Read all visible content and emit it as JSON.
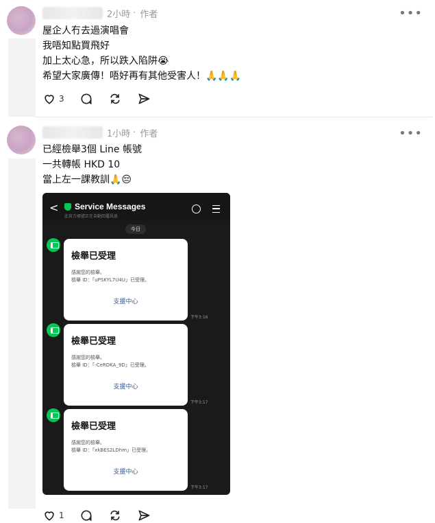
{
  "post1": {
    "time": "2小時",
    "separator": "·",
    "role": "作者",
    "more": "•••",
    "lines": [
      "屋企人冇去過演唱會",
      "我唔知點買飛好",
      "加上太心急，所以跌入陷阱😭",
      "希望大家廣傳！唔好再有其他受害人！🙏🙏🙏"
    ],
    "like_count": "3"
  },
  "post2": {
    "time": "1小時",
    "separator": "·",
    "role": "作者",
    "more": "•••",
    "lines": [
      "已經檢舉3個 Line 帳號",
      "一共轉帳 HKD 10",
      "當上左一課教訓🙏😔"
    ],
    "like_count": "1"
  },
  "line_screenshot": {
    "back": "<",
    "header_title": "Service Messages",
    "header_subtitle": "此官方帳號正在自動回覆訊息",
    "date_label": "今日",
    "cards": [
      {
        "title": "檢舉已受理",
        "thanks": "感謝您的檢舉。",
        "report_line": "檢舉 ID：「uPSKYL7U4U」已受理。",
        "link": "支援中心",
        "time": "下午3:16"
      },
      {
        "title": "檢舉已受理",
        "thanks": "感謝您的檢舉。",
        "report_line": "檢舉 ID：「-CeRDKA_9D」已受理。",
        "link": "支援中心",
        "time": "下午3:17"
      },
      {
        "title": "檢舉已受理",
        "thanks": "感謝您的檢舉。",
        "report_line": "檢舉 ID：「xkBES2LDhm」已受理。",
        "link": "支援中心",
        "time": "下午3:17"
      }
    ]
  },
  "colors": {
    "line_green": "#06c755",
    "link_blue": "#3a5a8c"
  },
  "icons": [
    "heart-icon",
    "comment-icon",
    "repost-icon",
    "share-icon",
    "shield-icon",
    "clock-icon",
    "menu-icon",
    "megaphone-icon"
  ]
}
